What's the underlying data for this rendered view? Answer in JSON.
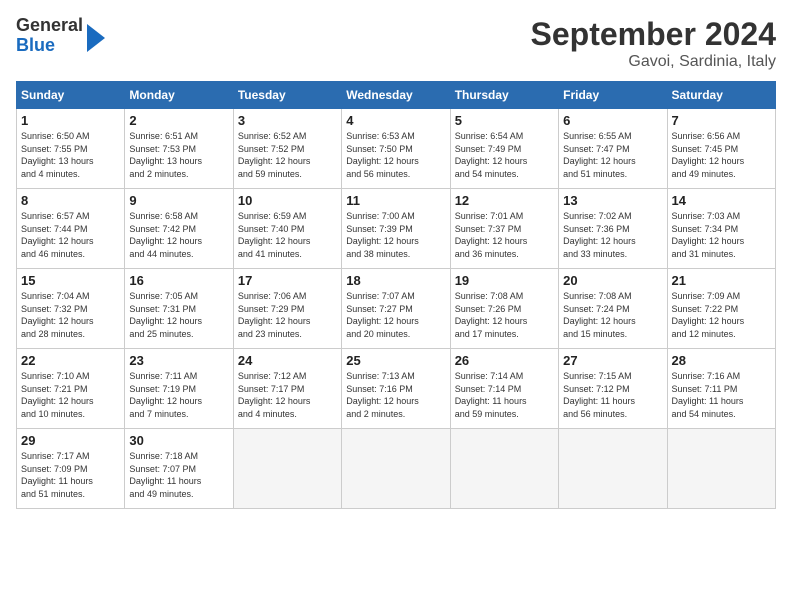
{
  "header": {
    "logo_general": "General",
    "logo_blue": "Blue",
    "title": "September 2024",
    "location": "Gavoi, Sardinia, Italy"
  },
  "days_of_week": [
    "Sunday",
    "Monday",
    "Tuesday",
    "Wednesday",
    "Thursday",
    "Friday",
    "Saturday"
  ],
  "weeks": [
    [
      {
        "day": "1",
        "info": "Sunrise: 6:50 AM\nSunset: 7:55 PM\nDaylight: 13 hours\nand 4 minutes."
      },
      {
        "day": "2",
        "info": "Sunrise: 6:51 AM\nSunset: 7:53 PM\nDaylight: 13 hours\nand 2 minutes."
      },
      {
        "day": "3",
        "info": "Sunrise: 6:52 AM\nSunset: 7:52 PM\nDaylight: 12 hours\nand 59 minutes."
      },
      {
        "day": "4",
        "info": "Sunrise: 6:53 AM\nSunset: 7:50 PM\nDaylight: 12 hours\nand 56 minutes."
      },
      {
        "day": "5",
        "info": "Sunrise: 6:54 AM\nSunset: 7:49 PM\nDaylight: 12 hours\nand 54 minutes."
      },
      {
        "day": "6",
        "info": "Sunrise: 6:55 AM\nSunset: 7:47 PM\nDaylight: 12 hours\nand 51 minutes."
      },
      {
        "day": "7",
        "info": "Sunrise: 6:56 AM\nSunset: 7:45 PM\nDaylight: 12 hours\nand 49 minutes."
      }
    ],
    [
      {
        "day": "8",
        "info": "Sunrise: 6:57 AM\nSunset: 7:44 PM\nDaylight: 12 hours\nand 46 minutes."
      },
      {
        "day": "9",
        "info": "Sunrise: 6:58 AM\nSunset: 7:42 PM\nDaylight: 12 hours\nand 44 minutes."
      },
      {
        "day": "10",
        "info": "Sunrise: 6:59 AM\nSunset: 7:40 PM\nDaylight: 12 hours\nand 41 minutes."
      },
      {
        "day": "11",
        "info": "Sunrise: 7:00 AM\nSunset: 7:39 PM\nDaylight: 12 hours\nand 38 minutes."
      },
      {
        "day": "12",
        "info": "Sunrise: 7:01 AM\nSunset: 7:37 PM\nDaylight: 12 hours\nand 36 minutes."
      },
      {
        "day": "13",
        "info": "Sunrise: 7:02 AM\nSunset: 7:36 PM\nDaylight: 12 hours\nand 33 minutes."
      },
      {
        "day": "14",
        "info": "Sunrise: 7:03 AM\nSunset: 7:34 PM\nDaylight: 12 hours\nand 31 minutes."
      }
    ],
    [
      {
        "day": "15",
        "info": "Sunrise: 7:04 AM\nSunset: 7:32 PM\nDaylight: 12 hours\nand 28 minutes."
      },
      {
        "day": "16",
        "info": "Sunrise: 7:05 AM\nSunset: 7:31 PM\nDaylight: 12 hours\nand 25 minutes."
      },
      {
        "day": "17",
        "info": "Sunrise: 7:06 AM\nSunset: 7:29 PM\nDaylight: 12 hours\nand 23 minutes."
      },
      {
        "day": "18",
        "info": "Sunrise: 7:07 AM\nSunset: 7:27 PM\nDaylight: 12 hours\nand 20 minutes."
      },
      {
        "day": "19",
        "info": "Sunrise: 7:08 AM\nSunset: 7:26 PM\nDaylight: 12 hours\nand 17 minutes."
      },
      {
        "day": "20",
        "info": "Sunrise: 7:08 AM\nSunset: 7:24 PM\nDaylight: 12 hours\nand 15 minutes."
      },
      {
        "day": "21",
        "info": "Sunrise: 7:09 AM\nSunset: 7:22 PM\nDaylight: 12 hours\nand 12 minutes."
      }
    ],
    [
      {
        "day": "22",
        "info": "Sunrise: 7:10 AM\nSunset: 7:21 PM\nDaylight: 12 hours\nand 10 minutes."
      },
      {
        "day": "23",
        "info": "Sunrise: 7:11 AM\nSunset: 7:19 PM\nDaylight: 12 hours\nand 7 minutes."
      },
      {
        "day": "24",
        "info": "Sunrise: 7:12 AM\nSunset: 7:17 PM\nDaylight: 12 hours\nand 4 minutes."
      },
      {
        "day": "25",
        "info": "Sunrise: 7:13 AM\nSunset: 7:16 PM\nDaylight: 12 hours\nand 2 minutes."
      },
      {
        "day": "26",
        "info": "Sunrise: 7:14 AM\nSunset: 7:14 PM\nDaylight: 11 hours\nand 59 minutes."
      },
      {
        "day": "27",
        "info": "Sunrise: 7:15 AM\nSunset: 7:12 PM\nDaylight: 11 hours\nand 56 minutes."
      },
      {
        "day": "28",
        "info": "Sunrise: 7:16 AM\nSunset: 7:11 PM\nDaylight: 11 hours\nand 54 minutes."
      }
    ],
    [
      {
        "day": "29",
        "info": "Sunrise: 7:17 AM\nSunset: 7:09 PM\nDaylight: 11 hours\nand 51 minutes."
      },
      {
        "day": "30",
        "info": "Sunrise: 7:18 AM\nSunset: 7:07 PM\nDaylight: 11 hours\nand 49 minutes."
      },
      {
        "day": "",
        "info": ""
      },
      {
        "day": "",
        "info": ""
      },
      {
        "day": "",
        "info": ""
      },
      {
        "day": "",
        "info": ""
      },
      {
        "day": "",
        "info": ""
      }
    ]
  ]
}
